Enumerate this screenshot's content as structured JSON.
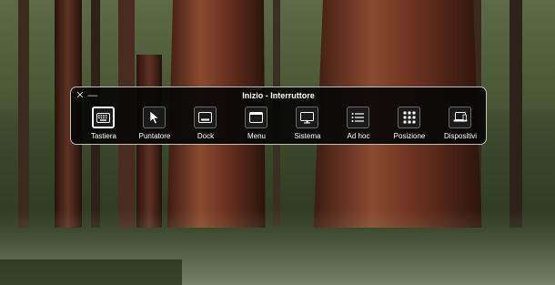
{
  "panel": {
    "title": "Inizio - Interruttore",
    "close_glyph": "✕",
    "minimize_glyph": "—"
  },
  "items": [
    {
      "label": "Tastiera",
      "icon": "keyboard-icon",
      "selected": true
    },
    {
      "label": "Puntatore",
      "icon": "pointer-icon"
    },
    {
      "label": "Dock",
      "icon": "dock-icon"
    },
    {
      "label": "Menu",
      "icon": "menu-bar-icon"
    },
    {
      "label": "Sistema",
      "icon": "display-icon"
    },
    {
      "label": "Ad hoc",
      "icon": "list-icon"
    },
    {
      "label": "Posizione",
      "icon": "grid-icon"
    },
    {
      "label": "Dispositivi",
      "icon": "devices-icon"
    }
  ]
}
